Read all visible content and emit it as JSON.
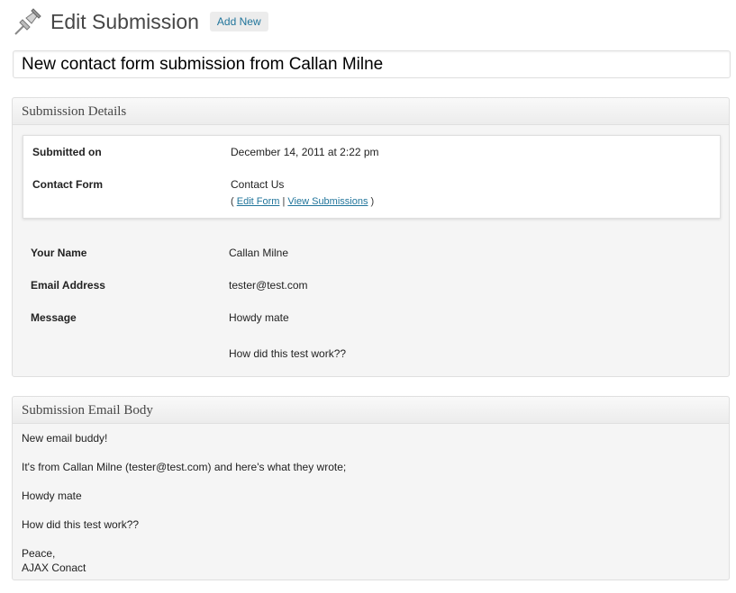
{
  "header": {
    "title": "Edit Submission",
    "add_new_label": "Add New",
    "icon": "pushpin-icon"
  },
  "title_field": {
    "value": "New contact form submission from Callan Milne"
  },
  "details_box": {
    "heading": "Submission Details",
    "submitted_on_label": "Submitted on",
    "submitted_on_value": "December 14, 2011 at 2:22 pm",
    "contact_form_label": "Contact Form",
    "contact_form_value": "Contact Us",
    "links_open": "( ",
    "edit_form_link": "Edit Form",
    "links_sep": " | ",
    "view_submissions_link": "View Submissions",
    "links_close": " )",
    "fields": [
      {
        "label": "Your Name",
        "value": "Callan Milne"
      },
      {
        "label": "Email Address",
        "value": "tester@test.com"
      },
      {
        "label": "Message",
        "value": "Howdy mate"
      }
    ],
    "message_line_2": "How did this test work??"
  },
  "email_box": {
    "heading": "Submission Email Body",
    "lines": [
      "New email buddy!",
      "It's from Callan Milne (tester@test.com) and here's what they wrote;",
      "Howdy mate",
      "How did this test work??"
    ],
    "signoff_1": "Peace,",
    "signoff_2": "AJAX Conact"
  },
  "colors": {
    "link": "#21759b",
    "border": "#dfdfdf",
    "box_bg": "#f5f5f5"
  }
}
